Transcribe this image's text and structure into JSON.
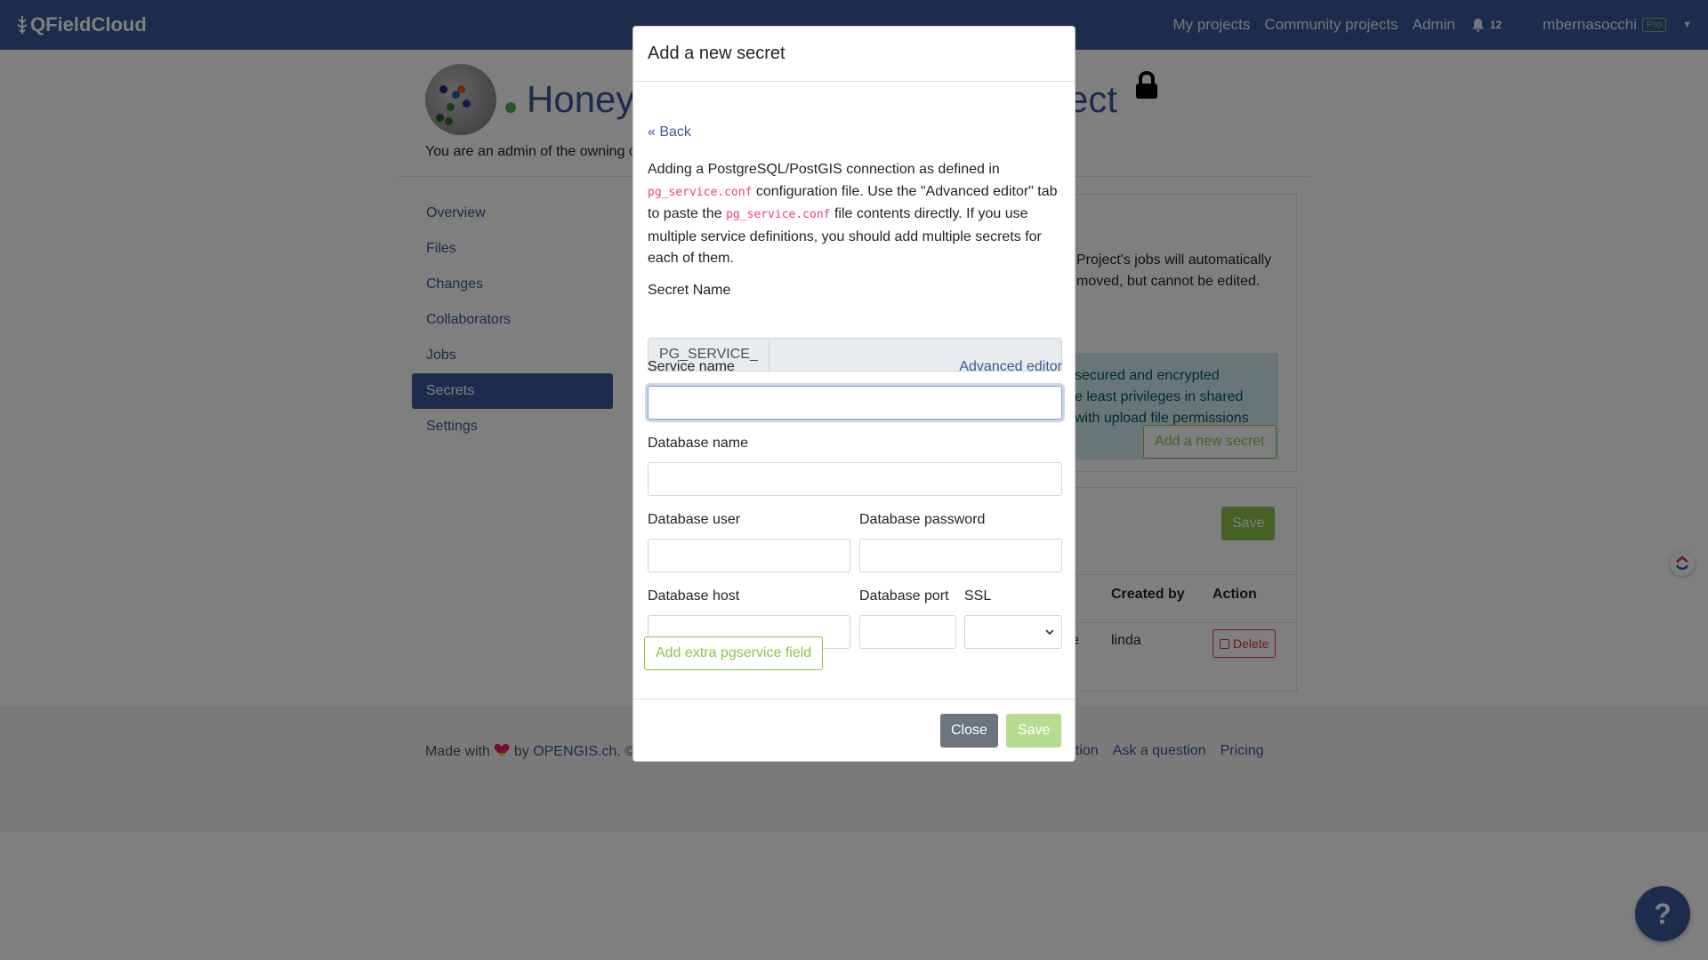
{
  "navbar": {
    "brand": "QFieldCloud",
    "links": [
      "My projects",
      "Community projects",
      "Admin"
    ],
    "notification_count": "12",
    "username": "mbernasocchi",
    "plan_badge": "Pro"
  },
  "project": {
    "title_start": "Honey",
    "title_end": "ect",
    "admin_note": "You are an admin of the owning o"
  },
  "sidebar": {
    "items": [
      {
        "label": "Overview"
      },
      {
        "label": "Files"
      },
      {
        "label": "Changes"
      },
      {
        "label": "Collaborators"
      },
      {
        "label": "Jobs"
      },
      {
        "label": "Secrets",
        "active": true
      },
      {
        "label": "Settings"
      }
    ]
  },
  "background_card": {
    "text_line1": "Project's jobs will automatically",
    "text_line2": "moved, but cannot be edited.",
    "info_line1": "secured and encrypted",
    "info_line2": "e least privileges in shared",
    "info_line3": "with upload file permissions",
    "add_button": "Add a new secret",
    "save_button": "Save",
    "col_created_by": "Created by",
    "col_action": "Action",
    "row_partial": "e",
    "row_user": "linda",
    "delete_button": "Delete"
  },
  "footer": {
    "made_with": "Made with",
    "by": "by",
    "company_link": "OPENGIS.ch",
    "company_suffix": ". ©",
    "links": [
      "ation",
      "Ask a question",
      "Pricing"
    ]
  },
  "help_button": "?",
  "modal": {
    "title": "Add a new secret",
    "back_link": "« Back",
    "intro_1": "Adding a PostgreSQL/PostGIS connection as defined in",
    "intro_code_1": "pg_service.conf",
    "intro_2": "configuration file. Use the \"Advanced editor\" tab to paste the",
    "intro_code_2": "pg_service.conf",
    "intro_3": "file contents directly. If you use multiple service definitions, you should add multiple secrets for each of them.",
    "secret_name_label": "Secret Name",
    "secret_name_prefix": "PG_SERVICE_",
    "service_name_label": "Service name",
    "advanced_editor_link": "Advanced editor",
    "database_name_label": "Database name",
    "database_user_label": "Database user",
    "database_password_label": "Database password",
    "database_host_label": "Database host",
    "database_port_label": "Database port",
    "ssl_label": "SSL",
    "add_extra_button": "Add extra pgservice field",
    "close_button": "Close",
    "save_button": "Save"
  },
  "colors": {
    "primary": "#3b5998",
    "success": "#8bc34a",
    "danger": "#dc3545",
    "code": "#e83e8c"
  }
}
